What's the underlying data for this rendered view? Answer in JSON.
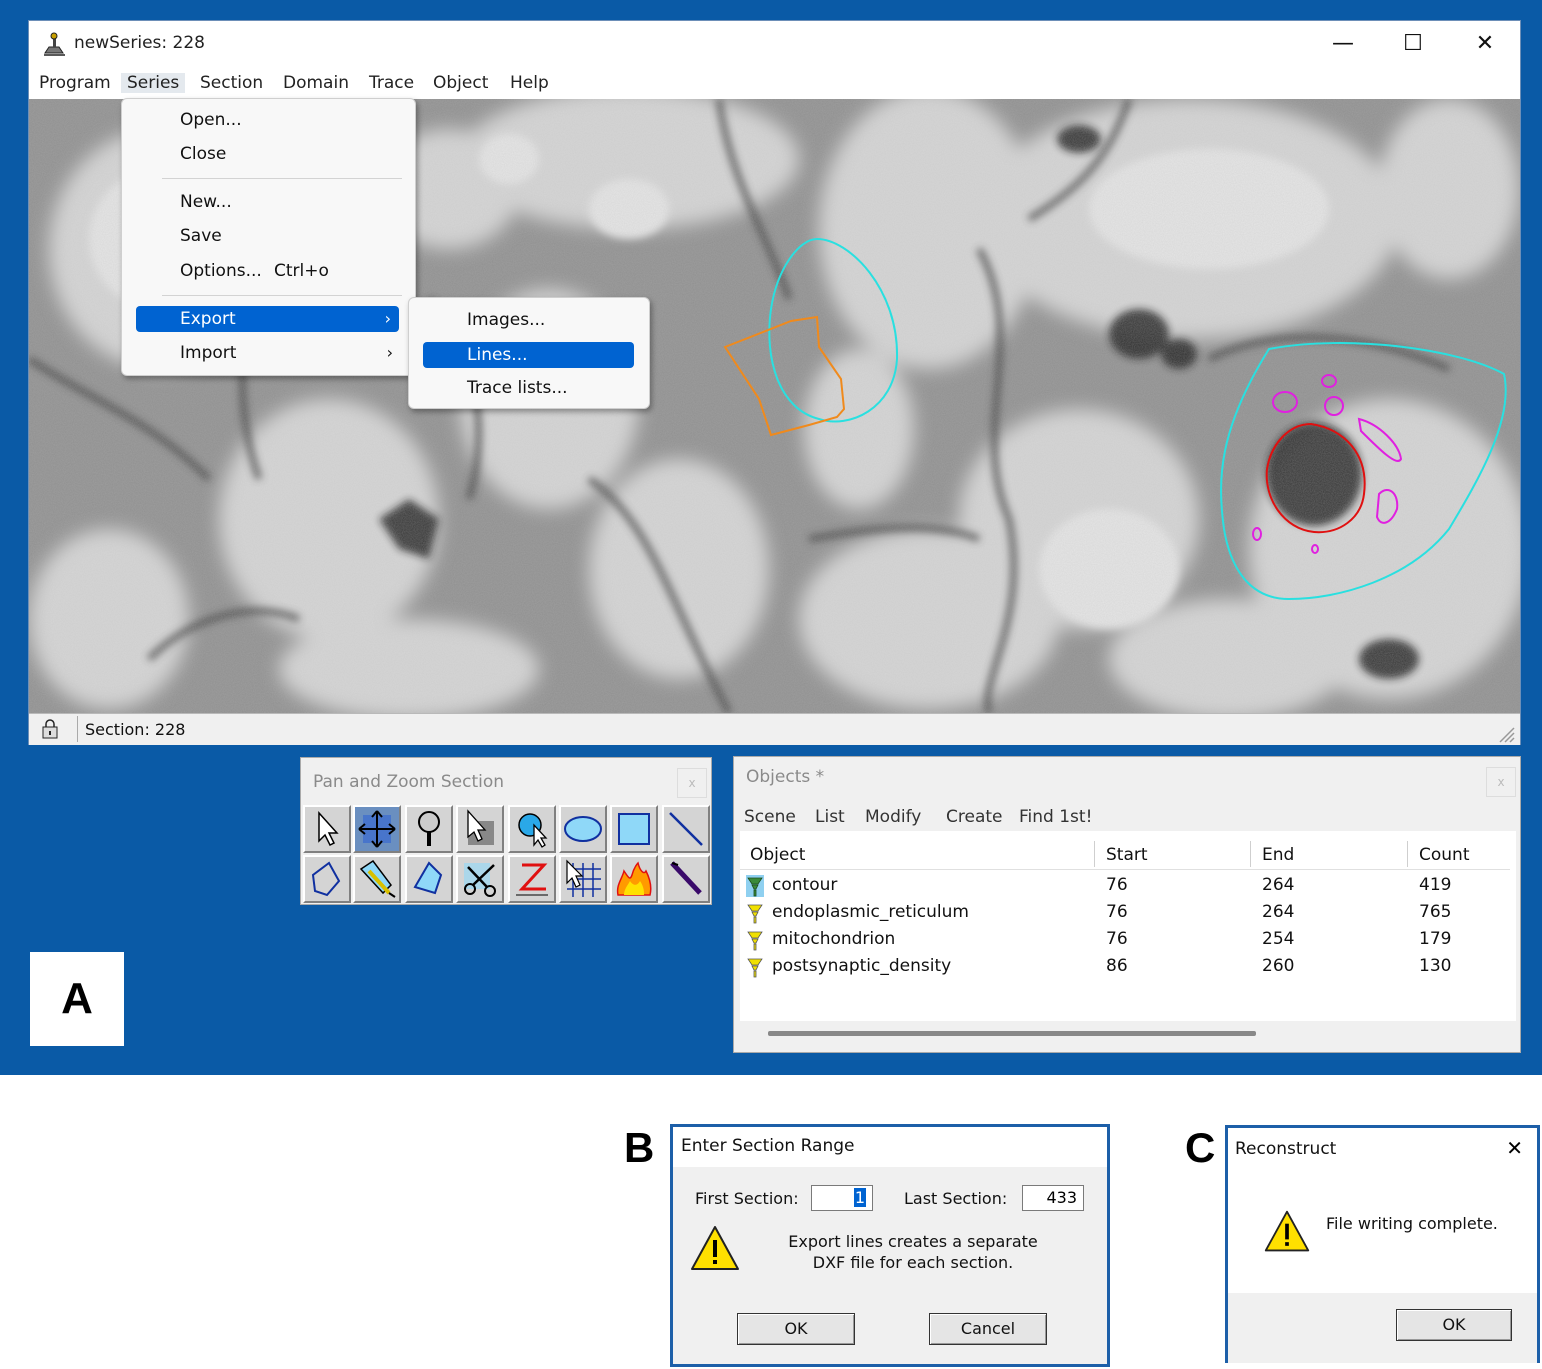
{
  "main_window": {
    "title": "newSeries: 228",
    "controls": {
      "minimize": "—",
      "maximize": "☐",
      "close": "✕"
    },
    "menubar": [
      "Program",
      "Series",
      "Section",
      "Domain",
      "Trace",
      "Object",
      "Help"
    ],
    "status": "Section: 228"
  },
  "series_menu": {
    "items": [
      "Open...",
      "Close",
      "New...",
      "Save",
      "Options...",
      "Export",
      "Import"
    ],
    "options_shortcut": "Ctrl+o",
    "highlighted": "Export"
  },
  "export_submenu": {
    "items": [
      "Images...",
      "Lines...",
      "Trace lists..."
    ],
    "highlighted": "Lines..."
  },
  "palette": {
    "title": "Pan and Zoom Section",
    "close": "x",
    "tools": [
      "pointer-tool",
      "pan-zoom-tool",
      "magnify-tool",
      "domain-select-tool",
      "circle-select-tool",
      "ellipse-tool",
      "rectangle-tool",
      "line-tool",
      "polygon-tool",
      "pencil-trace-tool",
      "wildfire-region-tool",
      "scissors-tool",
      "z-trace-tool",
      "grid-tool",
      "fire-tool",
      "knife-tool"
    ]
  },
  "objects": {
    "title": "Objects *",
    "close": "x",
    "menu": [
      "Scene",
      "List",
      "Modify",
      "Create",
      "Find 1st!"
    ],
    "columns": [
      "Object",
      "Start",
      "End",
      "Count"
    ],
    "rows": [
      {
        "name": "contour",
        "start": "76",
        "end": "264",
        "count": "419"
      },
      {
        "name": "endoplasmic_reticulum",
        "start": "76",
        "end": "264",
        "count": "765"
      },
      {
        "name": "mitochondrion",
        "start": "76",
        "end": "254",
        "count": "179"
      },
      {
        "name": "postsynaptic_density",
        "start": "86",
        "end": "260",
        "count": "130"
      }
    ]
  },
  "labels": {
    "a": "A",
    "b": "B",
    "c": "C"
  },
  "dialog_b": {
    "title": "Enter Section Range",
    "first_label": "First Section:",
    "first_value": "1",
    "last_label": "Last Section:",
    "last_value": "433",
    "message_line1": "Export lines creates a separate",
    "message_line2": "DXF file for each section.",
    "ok": "OK",
    "cancel": "Cancel"
  },
  "dialog_c": {
    "title": "Reconstruct",
    "close": "✕",
    "message": "File writing complete.",
    "ok": "OK"
  },
  "colors": {
    "desktop": "#0a5aa6",
    "highlight": "#0063d1",
    "trace_cyan": "#29e0e0",
    "trace_orange": "#f08a1c",
    "trace_red": "#e01010",
    "trace_magenta": "#e020e0"
  }
}
